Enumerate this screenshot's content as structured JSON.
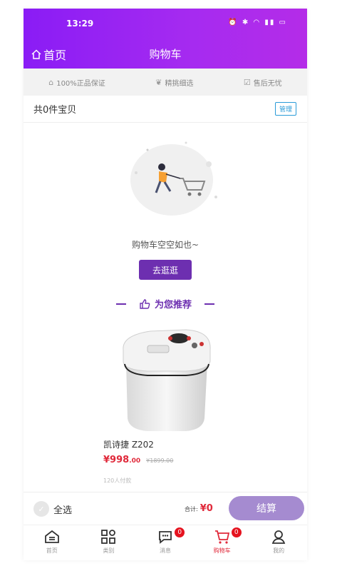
{
  "status_bar": {
    "time": "13:29",
    "icons": [
      "alarm-icon",
      "bluetooth-icon",
      "wifi-icon",
      "signal-icon",
      "battery-icon"
    ]
  },
  "header": {
    "home_label": "首页",
    "title": "购物车",
    "gradient_colors": [
      "#8a1cf5",
      "#b42ce8"
    ]
  },
  "guarantees": [
    {
      "icon": "home-icon",
      "label": "100%正品保证"
    },
    {
      "icon": "leaf-icon",
      "label": "精挑细选"
    },
    {
      "icon": "check-icon",
      "label": "售后无忧"
    }
  ],
  "cart": {
    "count_text": "共0件宝贝",
    "manage_label": "管理",
    "empty_text": "购物车空空如也~",
    "go_shopping_label": "去逛逛"
  },
  "recommend": {
    "title": "为您推荐",
    "products": [
      {
        "name": "凯诗捷 Z202",
        "price": "¥998",
        "price_decimal": ".00",
        "original_price": "¥1899.00",
        "sold": "120人付款"
      }
    ]
  },
  "checkout": {
    "select_all_label": "全选",
    "total_label": "合计:",
    "total_value": "¥0",
    "pay_label": "结算"
  },
  "tabbar": [
    {
      "label": "首页",
      "icon": "home-tab-icon",
      "active": false
    },
    {
      "label": "类别",
      "icon": "category-icon",
      "active": false
    },
    {
      "label": "消息",
      "icon": "message-icon",
      "active": false,
      "badge": "0"
    },
    {
      "label": "购物车",
      "icon": "cart-icon",
      "active": true,
      "badge": "0"
    },
    {
      "label": "我的",
      "icon": "user-icon",
      "active": false
    }
  ],
  "colors": {
    "accent": "#6d2fb0",
    "price_red": "#e0293a",
    "pay_button": "#a58bd0",
    "manage_blue": "#2a9bd8"
  }
}
